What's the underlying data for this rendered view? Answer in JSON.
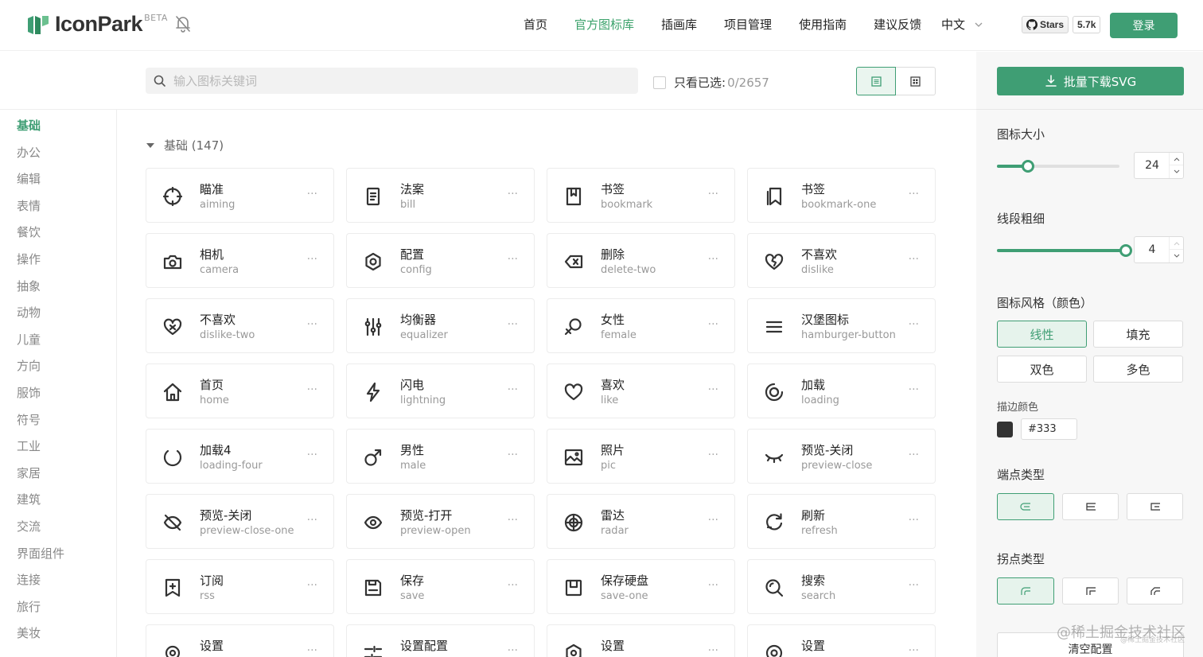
{
  "header": {
    "logo_text": "IconPark",
    "logo_badge": "BETA",
    "nav": [
      "首页",
      "官方图标库",
      "插画库",
      "项目管理",
      "使用指南",
      "建议反馈"
    ],
    "nav_active_index": 1,
    "language": "中文",
    "github_stars_label": "Stars",
    "github_stars_count": "5.7k",
    "login_label": "登录"
  },
  "toolbar": {
    "search_placeholder": "输入图标关键词",
    "only_selected_label": "只看已选:",
    "only_selected_count": "0/2657"
  },
  "sidebar": {
    "active_index": 0,
    "categories": [
      "基础",
      "办公",
      "编辑",
      "表情",
      "餐饮",
      "操作",
      "抽象",
      "动物",
      "儿童",
      "方向",
      "服饰",
      "符号",
      "工业",
      "家居",
      "建筑",
      "交流",
      "界面组件",
      "连接",
      "旅行",
      "美妆"
    ]
  },
  "section": {
    "title": "基础 (147)"
  },
  "icons": [
    {
      "cn": "瞄准",
      "en": "aiming",
      "icon": "aiming-icon"
    },
    {
      "cn": "法案",
      "en": "bill",
      "icon": "bill-icon"
    },
    {
      "cn": "书签",
      "en": "bookmark",
      "icon": "bookmark-icon"
    },
    {
      "cn": "书签",
      "en": "bookmark-one",
      "icon": "bookmark-one-icon"
    },
    {
      "cn": "相机",
      "en": "camera",
      "icon": "camera-icon"
    },
    {
      "cn": "配置",
      "en": "config",
      "icon": "config-icon"
    },
    {
      "cn": "删除",
      "en": "delete-two",
      "icon": "delete-two-icon"
    },
    {
      "cn": "不喜欢",
      "en": "dislike",
      "icon": "dislike-icon"
    },
    {
      "cn": "不喜欢",
      "en": "dislike-two",
      "icon": "dislike-two-icon"
    },
    {
      "cn": "均衡器",
      "en": "equalizer",
      "icon": "equalizer-icon"
    },
    {
      "cn": "女性",
      "en": "female",
      "icon": "female-icon"
    },
    {
      "cn": "汉堡图标",
      "en": "hamburger-button",
      "icon": "hamburger-button-icon"
    },
    {
      "cn": "首页",
      "en": "home",
      "icon": "home-icon"
    },
    {
      "cn": "闪电",
      "en": "lightning",
      "icon": "lightning-icon"
    },
    {
      "cn": "喜欢",
      "en": "like",
      "icon": "like-icon"
    },
    {
      "cn": "加载",
      "en": "loading",
      "icon": "loading-icon"
    },
    {
      "cn": "加载4",
      "en": "loading-four",
      "icon": "loading-four-icon"
    },
    {
      "cn": "男性",
      "en": "male",
      "icon": "male-icon"
    },
    {
      "cn": "照片",
      "en": "pic",
      "icon": "pic-icon"
    },
    {
      "cn": "预览-关闭",
      "en": "preview-close",
      "icon": "preview-close-icon"
    },
    {
      "cn": "预览-关闭",
      "en": "preview-close-one",
      "icon": "preview-close-one-icon"
    },
    {
      "cn": "预览-打开",
      "en": "preview-open",
      "icon": "preview-open-icon"
    },
    {
      "cn": "雷达",
      "en": "radar",
      "icon": "radar-icon"
    },
    {
      "cn": "刷新",
      "en": "refresh",
      "icon": "refresh-icon"
    },
    {
      "cn": "订阅",
      "en": "rss",
      "icon": "rss-icon"
    },
    {
      "cn": "保存",
      "en": "save",
      "icon": "save-icon"
    },
    {
      "cn": "保存硬盘",
      "en": "save-one",
      "icon": "save-one-icon"
    },
    {
      "cn": "搜索",
      "en": "search",
      "icon": "search-icon"
    },
    {
      "cn": "设置",
      "en": "",
      "icon": "setting-icon"
    },
    {
      "cn": "设置配置",
      "en": "",
      "icon": "setting-config-icon"
    },
    {
      "cn": "设置",
      "en": "",
      "icon": "setting-two-icon"
    },
    {
      "cn": "设置",
      "en": "",
      "icon": "setting-three-icon"
    }
  ],
  "more_glyph": "···",
  "panel": {
    "download_label": "批量下载SVG",
    "size_label": "图标大小",
    "size_value": "24",
    "size_fraction": 0.25,
    "stroke_label": "线段粗细",
    "stroke_value": "4",
    "stroke_fraction": 1.0,
    "style_label": "图标风格（颜色）",
    "styles": [
      "线性",
      "填充",
      "双色",
      "多色"
    ],
    "style_active_index": 0,
    "stroke_color_label": "描边颜色",
    "stroke_color": "#333",
    "cap_label": "端点类型",
    "join_label": "拐点类型",
    "reset_label": "清空配置"
  },
  "colors": {
    "accent": "#3f9e74",
    "accent_light": "#e6f3ec",
    "text": "#333333",
    "muted": "#999999"
  },
  "watermark": "@稀土掘金技术社区",
  "watermark_small": "@稀土掘金技术社区"
}
